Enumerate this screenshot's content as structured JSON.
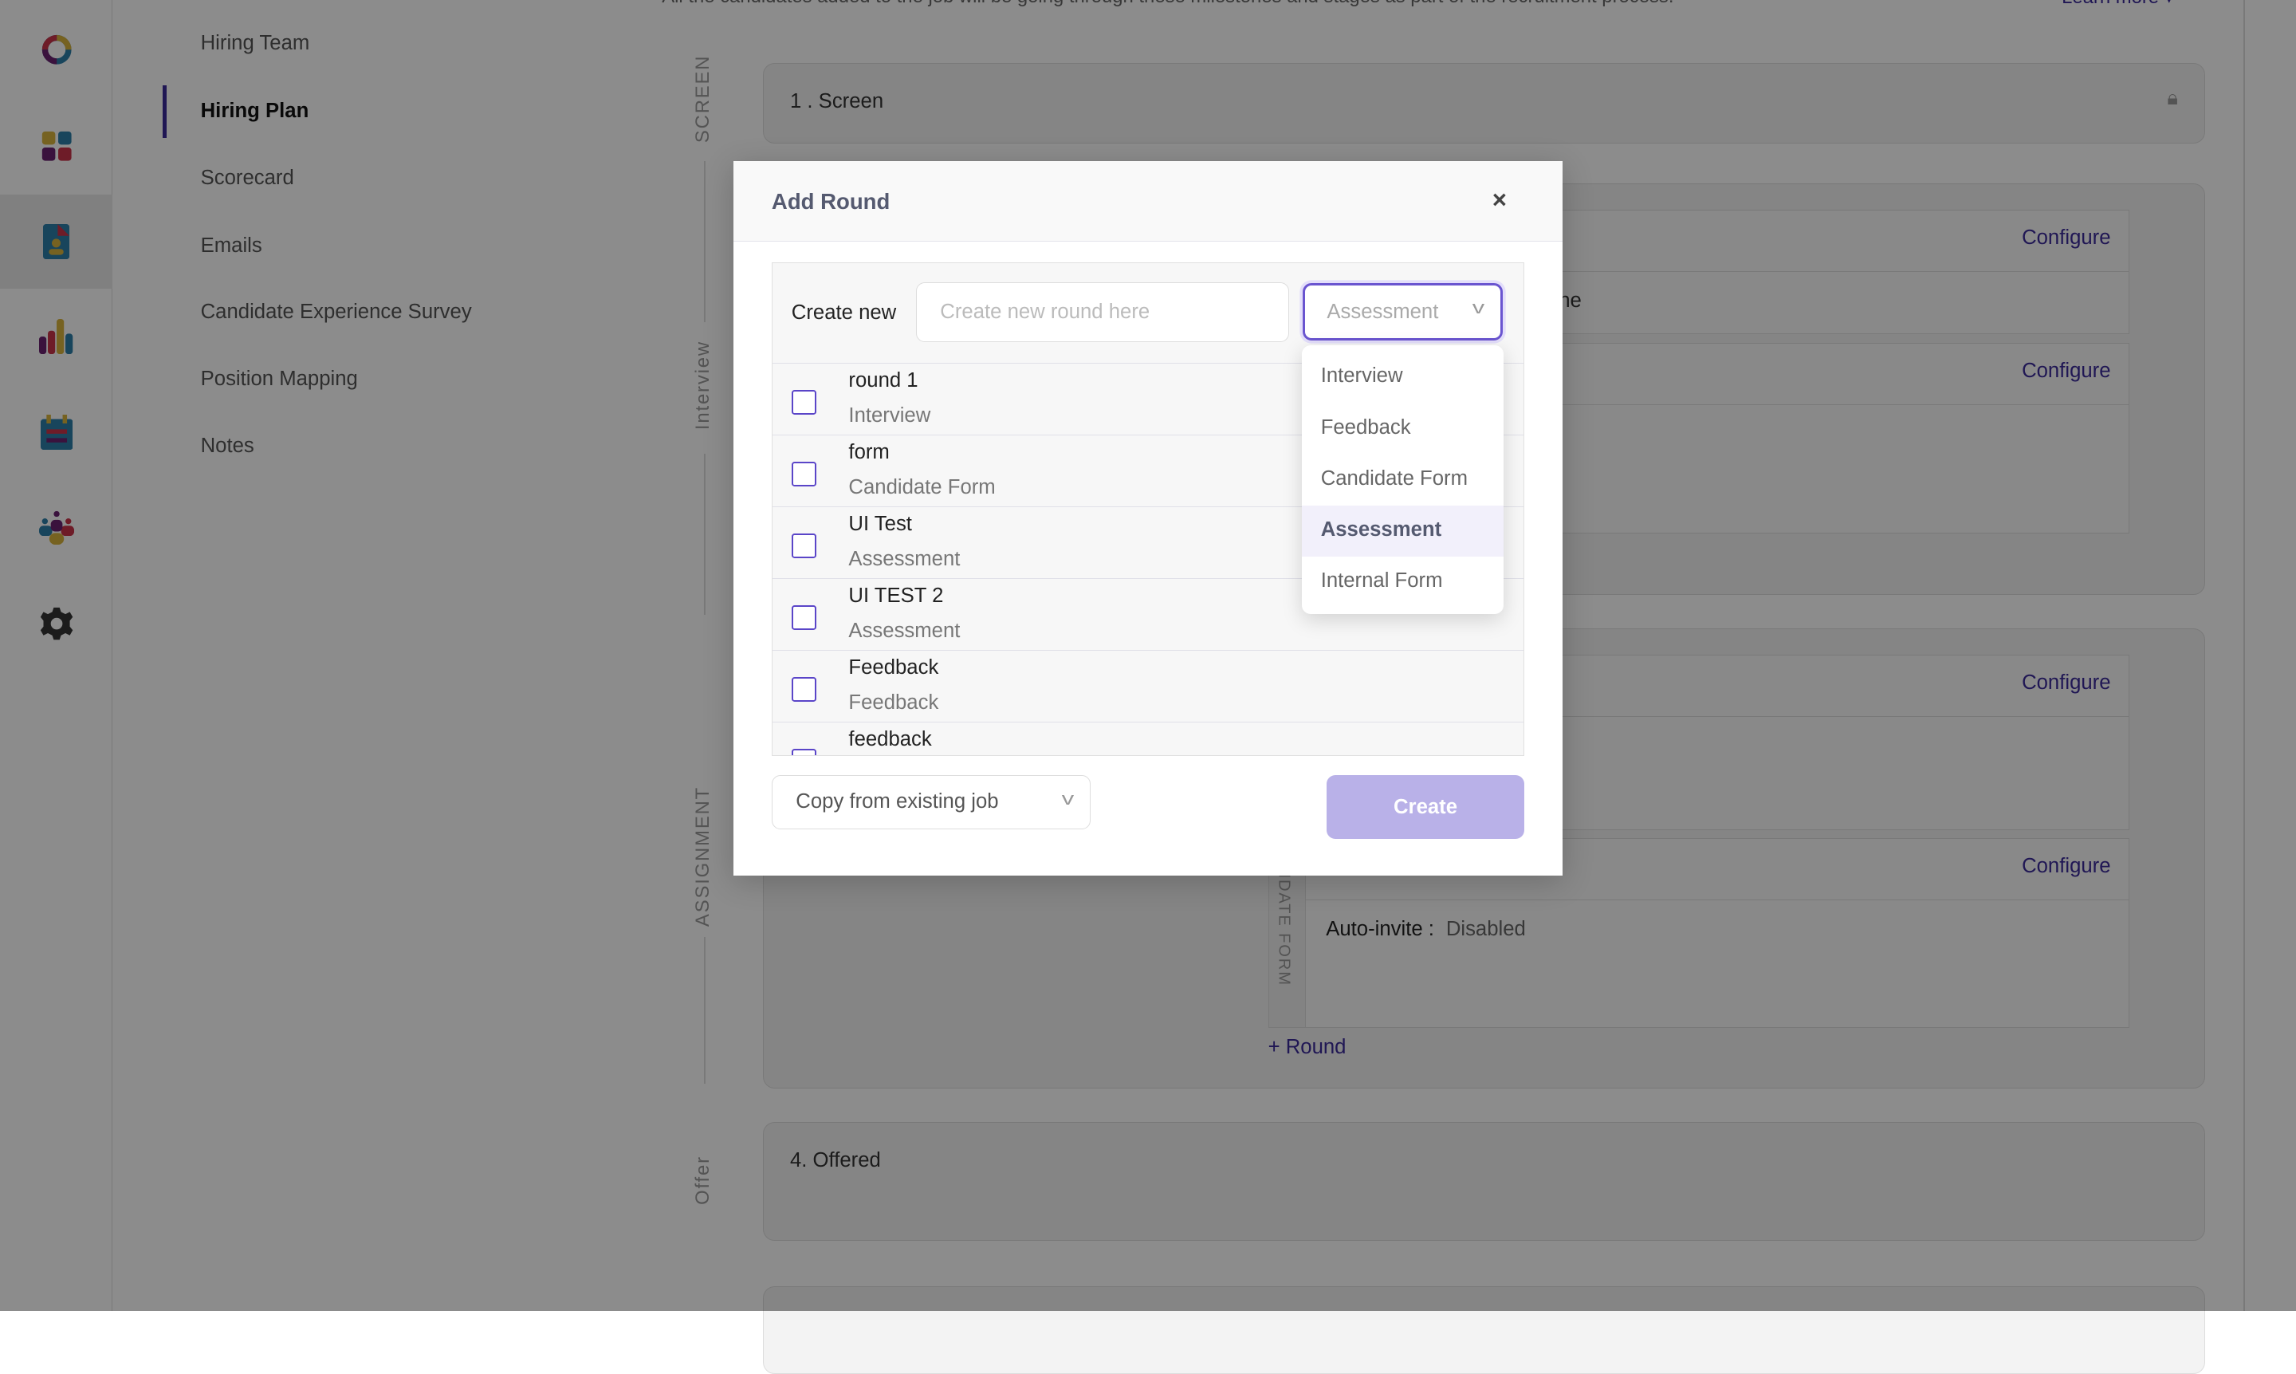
{
  "intro_text": "All the candidates added to the job will be going through these milestones and stages as part of the recruitment process.",
  "learn_more": "Learn more ▾",
  "nav": [
    "Hiring Team",
    "Hiring Plan",
    "Scorecard",
    "Emails",
    "Candidate Experience Survey",
    "Position Mapping",
    "Notes"
  ],
  "active_nav": "Hiring Plan",
  "stages": {
    "screen_label": "SCREEN",
    "interview_label": "Interview",
    "assignment_label": "ASSIGNMENT",
    "offer_label": "Offer"
  },
  "cards": {
    "screen": "1 . Screen",
    "offered": "4. Offered",
    "configure": "Configure",
    "partial_text": "ne",
    "candidate_form_label": "NDIDATE FORM",
    "auto_invite_label": "Auto-invite :",
    "auto_invite_value": "Disabled",
    "add_round": "+ Round"
  },
  "modal": {
    "title": "Add Round",
    "close": "×",
    "create_new_label": "Create new",
    "input_placeholder": "Create new round here",
    "input_value": "",
    "type_selected": "Assessment",
    "type_options": [
      "Interview",
      "Feedback",
      "Candidate Form",
      "Assessment",
      "Internal Form"
    ],
    "rounds": [
      {
        "name": "round 1",
        "type": "Interview"
      },
      {
        "name": "form",
        "type": "Candidate Form"
      },
      {
        "name": "UI Test",
        "type": "Assessment"
      },
      {
        "name": "UI TEST 2",
        "type": "Assessment"
      },
      {
        "name": "Feedback",
        "type": "Feedback"
      },
      {
        "name": "feedback",
        "type": ""
      }
    ],
    "copy_label": "Copy from existing job",
    "create_label": "Create"
  },
  "colors": {
    "accent": "#3b2a9a",
    "create_disabled": "#b9b1e8"
  }
}
